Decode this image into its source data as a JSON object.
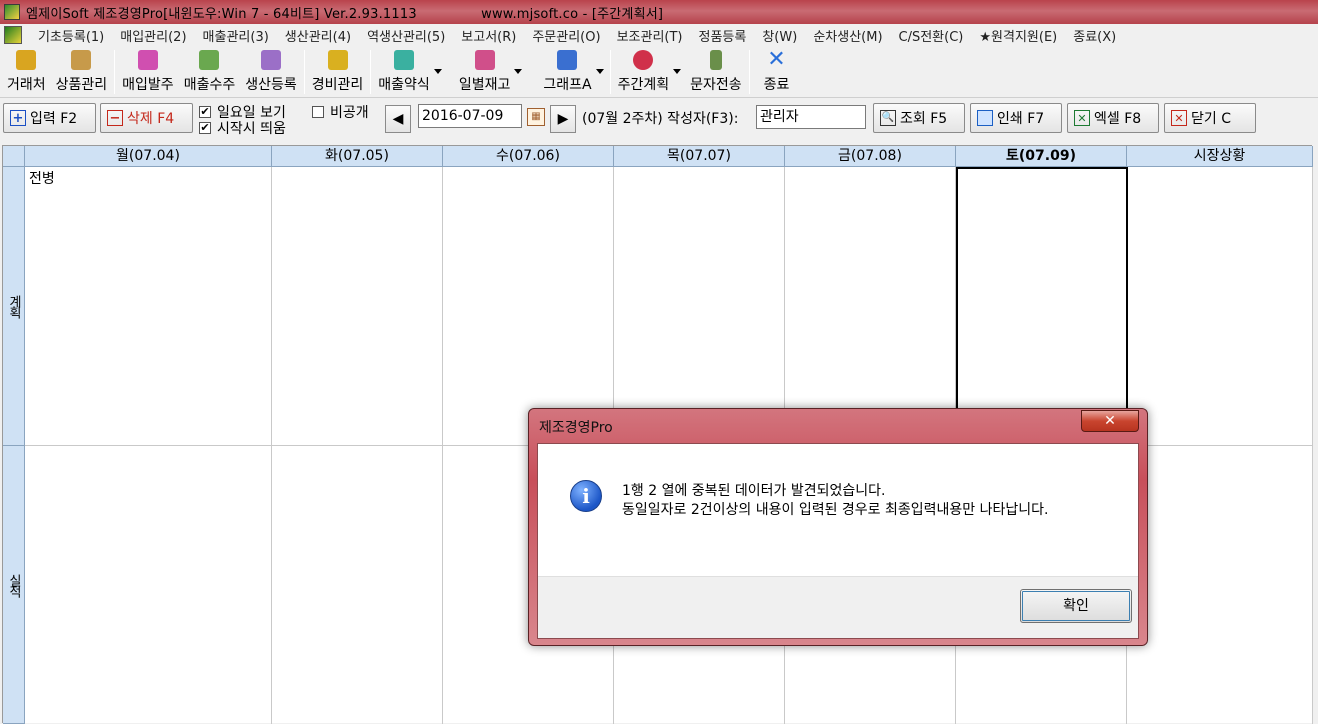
{
  "window": {
    "title": "엠제이Soft 제조경영Pro[내윈도우:Win 7 - 64비트] Ver.2.93.1113",
    "url_text": "www.mjsoft.co - [주간계획서]"
  },
  "menu": [
    "기초등록(1)",
    "매입관리(2)",
    "매출관리(3)",
    "생산관리(4)",
    "역생산관리(5)",
    "보고서(R)",
    "주문관리(O)",
    "보조관리(T)",
    "정품등록",
    "창(W)",
    "순차생산(M)",
    "C/S전환(C)",
    "★원격지원(E)",
    "종료(X)"
  ],
  "toolbar": {
    "items": [
      {
        "label": "거래처",
        "icon": "people-icon",
        "color": "#d9a520"
      },
      {
        "label": "상품관리",
        "icon": "box-icon",
        "color": "#c79a4a"
      },
      {
        "label": "매입발주",
        "icon": "order-icon",
        "color": "#d04fb0"
      },
      {
        "label": "매출수주",
        "icon": "receipt-icon",
        "color": "#6aa84f"
      },
      {
        "label": "생산등록",
        "icon": "gears-icon",
        "color": "#9b6fc7"
      },
      {
        "label": "경비관리",
        "icon": "coins-icon",
        "color": "#d9b020"
      },
      {
        "label": "매출약식",
        "icon": "note-icon",
        "color": "#3ab0a0"
      },
      {
        "label": "일별재고",
        "icon": "stock-icon",
        "color": "#d04f8a"
      },
      {
        "label": "그래프A",
        "icon": "chart-icon",
        "color": "#3a6fd0"
      },
      {
        "label": "주간계획",
        "icon": "plan-icon",
        "color": "#d0304a"
      },
      {
        "label": "문자전송",
        "icon": "phone-icon",
        "color": "#6a8f4a"
      },
      {
        "label": "종료",
        "icon": "exit-icon",
        "color": "#2a6fd9"
      }
    ]
  },
  "actions": {
    "add": "입력 F2",
    "delete": "삭제 F4",
    "show_sunday": "일요일 보기",
    "open_at_start": "시작시 띄움",
    "private": "비공개",
    "date": "2016-07-09",
    "week_info": "(07월 2주차) 작성자(F3):",
    "author": "관리자",
    "search": "조회 F5",
    "print": "인쇄 F7",
    "excel": "엑셀 F8",
    "close": "닫기 C"
  },
  "grid": {
    "columns": [
      "월(07.04)",
      "화(07.05)",
      "수(07.06)",
      "목(07.07)",
      "금(07.08)",
      "토(07.09)",
      "시장상황"
    ],
    "rows": [
      "계획",
      "실적"
    ],
    "plan_monday": "전병"
  },
  "dialog": {
    "title": "제조경영Pro",
    "close_glyph": "✕",
    "line1": "1행 2 열에 중복된 데이터가 발견되었습니다.",
    "line2": "동일일자로 2건이상의 내용이 입력된 경우로 최종입력내용만 나타납니다.",
    "ok": "확인"
  }
}
